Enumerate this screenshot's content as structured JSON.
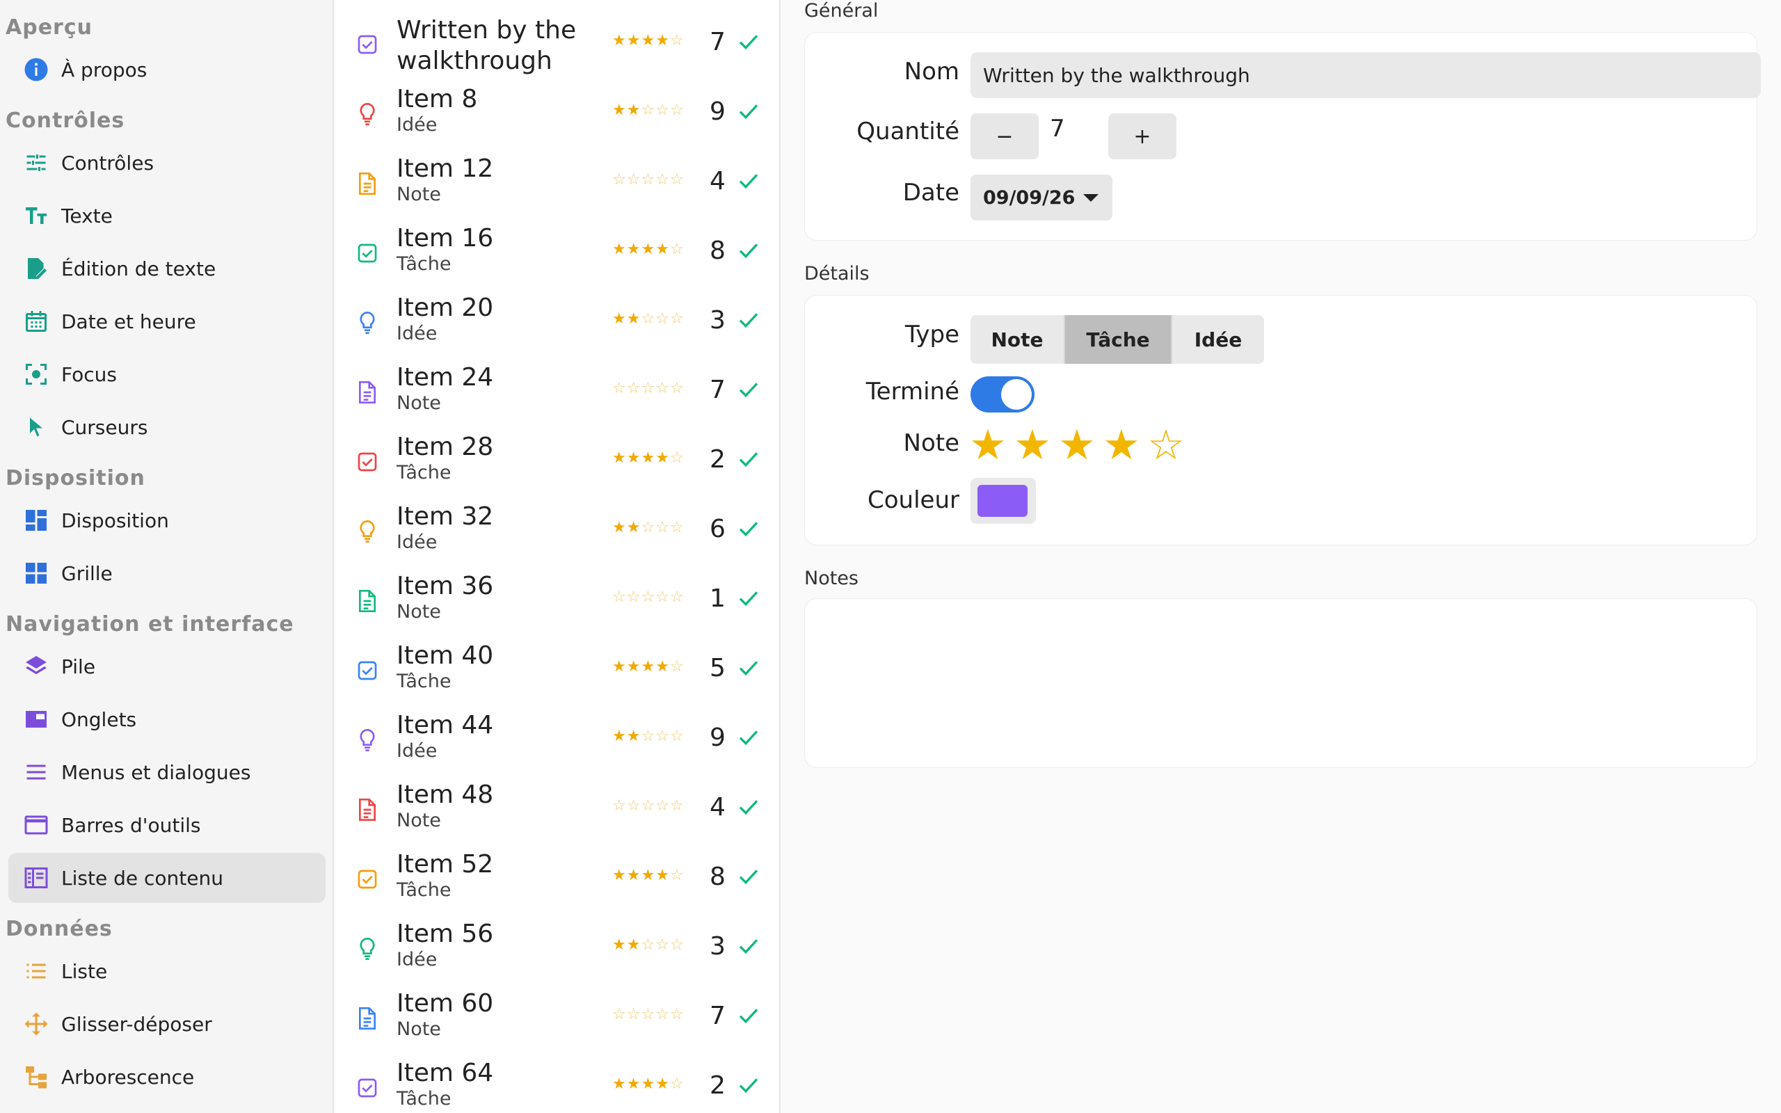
{
  "sidebar": {
    "sections": [
      {
        "title": "Aperçu",
        "items": [
          {
            "label": "À propos",
            "icon": "info-icon"
          }
        ]
      },
      {
        "title": "Contrôles",
        "items": [
          {
            "label": "Contrôles",
            "icon": "sliders-icon"
          },
          {
            "label": "Texte",
            "icon": "text-format-icon"
          },
          {
            "label": "Édition de texte",
            "icon": "edit-document-icon"
          },
          {
            "label": "Date et heure",
            "icon": "calendar-icon"
          },
          {
            "label": "Focus",
            "icon": "focus-icon"
          },
          {
            "label": "Curseurs",
            "icon": "cursor-icon"
          }
        ]
      },
      {
        "title": "Disposition",
        "items": [
          {
            "label": "Disposition",
            "icon": "layout-icon"
          },
          {
            "label": "Grille",
            "icon": "grid-icon"
          }
        ]
      },
      {
        "title": "Navigation et interface",
        "items": [
          {
            "label": "Pile",
            "icon": "stack-icon"
          },
          {
            "label": "Onglets",
            "icon": "tabs-icon"
          },
          {
            "label": "Menus et dialogues",
            "icon": "menu-icon"
          },
          {
            "label": "Barres d'outils",
            "icon": "toolbar-icon"
          },
          {
            "label": "Liste de contenu",
            "icon": "content-list-icon"
          }
        ]
      },
      {
        "title": "Données",
        "items": [
          {
            "label": "Liste",
            "icon": "list-icon"
          },
          {
            "label": "Glisser-déposer",
            "icon": "move-icon"
          },
          {
            "label": "Arborescence",
            "icon": "tree-icon"
          }
        ]
      }
    ],
    "selected": "Liste de contenu"
  },
  "list": {
    "rows": [
      {
        "title": "Written by the walkthrough",
        "subtitle": "",
        "icon": "task-icon",
        "color": "#8b5cf6",
        "stars": 4,
        "qty": "7"
      },
      {
        "title": "Item 8",
        "subtitle": "Idée",
        "icon": "idea-icon",
        "color": "#ef4444",
        "stars": 2,
        "qty": "9"
      },
      {
        "title": "Item 12",
        "subtitle": "Note",
        "icon": "note-icon",
        "color": "#f59e0b",
        "stars": 0,
        "qty": "4"
      },
      {
        "title": "Item 16",
        "subtitle": "Tâche",
        "icon": "task-icon",
        "color": "#10b981",
        "stars": 4,
        "qty": "8"
      },
      {
        "title": "Item 20",
        "subtitle": "Idée",
        "icon": "idea-icon",
        "color": "#3b82f6",
        "stars": 2,
        "qty": "3"
      },
      {
        "title": "Item 24",
        "subtitle": "Note",
        "icon": "note-icon",
        "color": "#8b5cf6",
        "stars": 0,
        "qty": "7"
      },
      {
        "title": "Item 28",
        "subtitle": "Tâche",
        "icon": "task-icon",
        "color": "#ef4444",
        "stars": 4,
        "qty": "2"
      },
      {
        "title": "Item 32",
        "subtitle": "Idée",
        "icon": "idea-icon",
        "color": "#f59e0b",
        "stars": 2,
        "qty": "6"
      },
      {
        "title": "Item 36",
        "subtitle": "Note",
        "icon": "note-icon",
        "color": "#10b981",
        "stars": 0,
        "qty": "1"
      },
      {
        "title": "Item 40",
        "subtitle": "Tâche",
        "icon": "task-icon",
        "color": "#3b82f6",
        "stars": 4,
        "qty": "5"
      },
      {
        "title": "Item 44",
        "subtitle": "Idée",
        "icon": "idea-icon",
        "color": "#8b5cf6",
        "stars": 2,
        "qty": "9"
      },
      {
        "title": "Item 48",
        "subtitle": "Note",
        "icon": "note-icon",
        "color": "#ef4444",
        "stars": 0,
        "qty": "4"
      },
      {
        "title": "Item 52",
        "subtitle": "Tâche",
        "icon": "task-icon",
        "color": "#f59e0b",
        "stars": 4,
        "qty": "8"
      },
      {
        "title": "Item 56",
        "subtitle": "Idée",
        "icon": "idea-icon",
        "color": "#10b981",
        "stars": 2,
        "qty": "3"
      },
      {
        "title": "Item 60",
        "subtitle": "Note",
        "icon": "note-icon",
        "color": "#3b82f6",
        "stars": 0,
        "qty": "7"
      },
      {
        "title": "Item 64",
        "subtitle": "Tâche",
        "icon": "task-icon",
        "color": "#8b5cf6",
        "stars": 4,
        "qty": "2"
      }
    ],
    "check_color": "#10b981",
    "star_color": "#f2a900"
  },
  "detail": {
    "general": {
      "title": "Général",
      "name_label": "Nom",
      "name_value": "Written by the walkthrough",
      "qty_label": "Quantité",
      "qty_value": "7",
      "minus_label": "−",
      "plus_label": "+",
      "date_label": "Date",
      "date_value": "09/09/26"
    },
    "details": {
      "title": "Détails",
      "type_label": "Type",
      "type_options": [
        "Note",
        "Tâche",
        "Idée"
      ],
      "type_selected": "Tâche",
      "done_label": "Terminé",
      "done_value": true,
      "rating_label": "Note",
      "rating_value": 4,
      "rating_max": 5,
      "color_label": "Couleur",
      "color_value": "#8b5cf6"
    },
    "notes": {
      "title": "Notes",
      "value": ""
    }
  },
  "colors": {
    "accent": "#2f7be6",
    "star": "#f2b600"
  }
}
